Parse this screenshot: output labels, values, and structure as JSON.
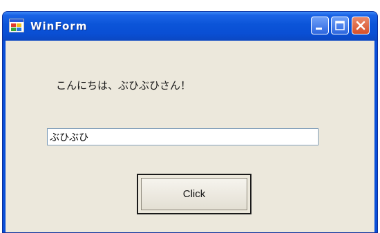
{
  "window": {
    "title": "WinForm"
  },
  "controls": {
    "minimize": "minimize",
    "maximize": "maximize",
    "close": "close"
  },
  "form": {
    "greeting": "こんにちは、ぶひぶひさん！",
    "textbox_value": "ぶひぶひ",
    "button_label": "Click"
  },
  "colors": {
    "titlebar": "#0b54d8",
    "client_background": "#ece8dc",
    "close_button": "#d6502a"
  },
  "icons": {
    "app": "winform-app-icon",
    "minimize": "minimize-icon",
    "maximize": "maximize-icon",
    "close": "close-icon"
  }
}
